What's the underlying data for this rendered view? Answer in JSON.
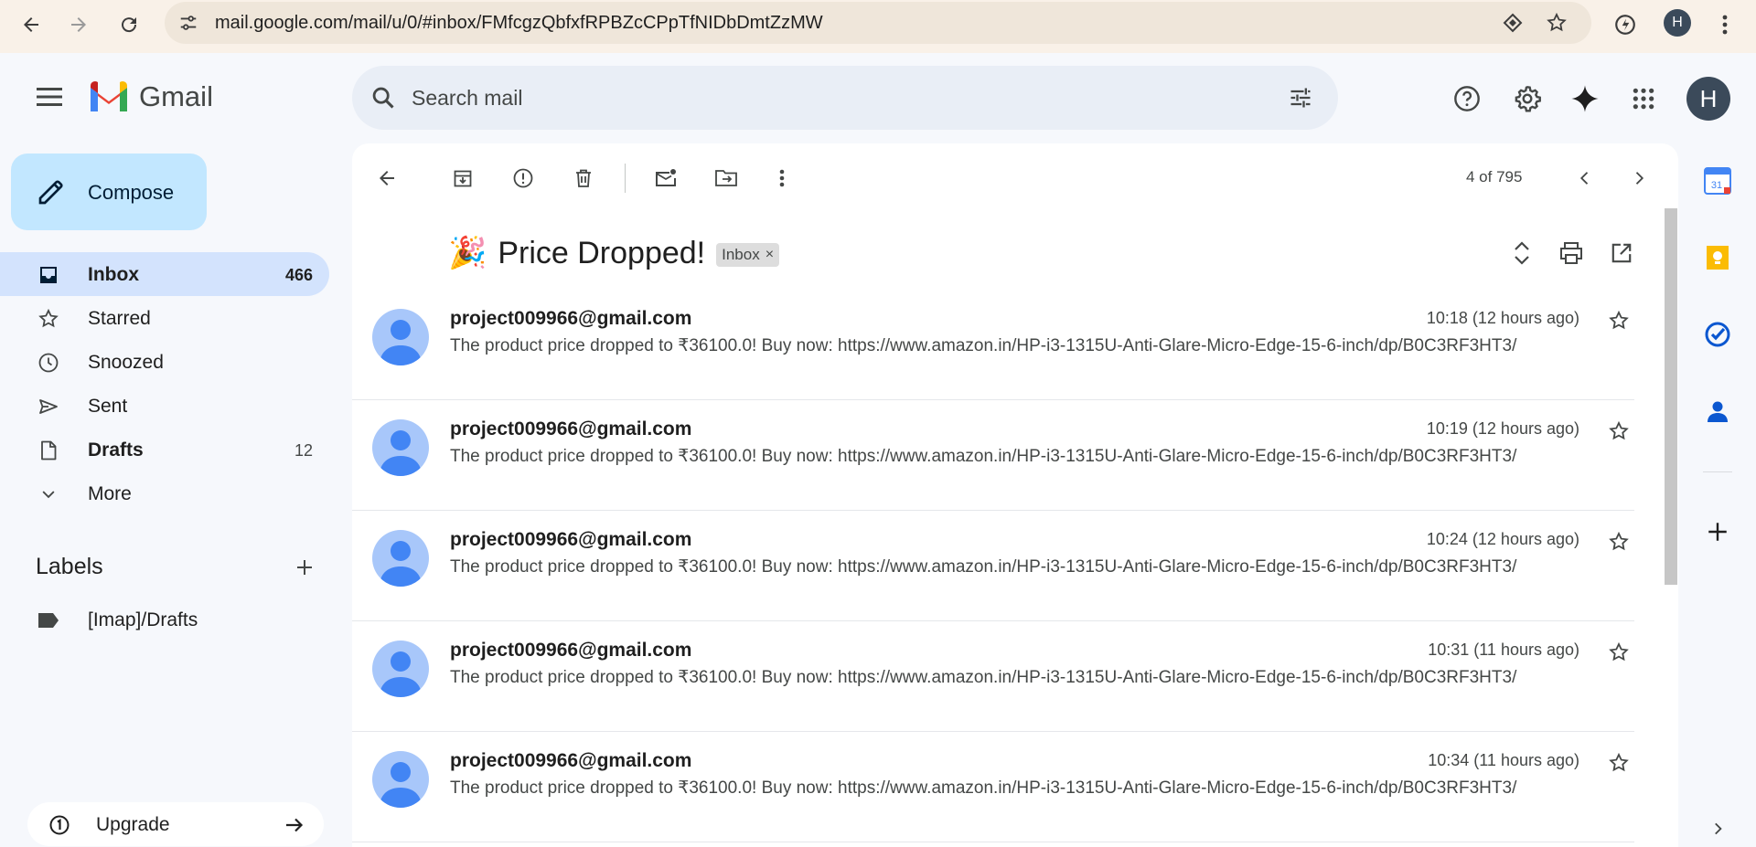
{
  "browser": {
    "url": "mail.google.com/mail/u/0/#inbox/FMfcgzQbfxfRPBZcCPpTfNIDbDmtZzMW",
    "profile_initial": "H"
  },
  "header": {
    "app_name": "Gmail",
    "search_placeholder": "Search mail",
    "account_initial": "H"
  },
  "sidebar": {
    "compose_label": "Compose",
    "items": [
      {
        "label": "Inbox",
        "count": "466"
      },
      {
        "label": "Starred",
        "count": ""
      },
      {
        "label": "Snoozed",
        "count": ""
      },
      {
        "label": "Sent",
        "count": ""
      },
      {
        "label": "Drafts",
        "count": "12"
      },
      {
        "label": "More",
        "count": ""
      }
    ],
    "labels_heading": "Labels",
    "labels": [
      {
        "label": "[Imap]/Drafts"
      }
    ],
    "upgrade_label": "Upgrade"
  },
  "toolbar": {
    "pager": "4 of 795"
  },
  "thread": {
    "emoji": "🎉",
    "subject": "Price Dropped!",
    "chip": "Inbox",
    "chip_close": "×",
    "messages": [
      {
        "from": "project009966@gmail.com",
        "time": "10:18 (12 hours ago)",
        "snippet": "The product price dropped to ₹36100.0! Buy now: https://www.amazon.in/HP-i3-1315U-Anti-Glare-Micro-Edge-15-6-inch/dp/B0C3RF3HT3/"
      },
      {
        "from": "project009966@gmail.com",
        "time": "10:19 (12 hours ago)",
        "snippet": "The product price dropped to ₹36100.0! Buy now: https://www.amazon.in/HP-i3-1315U-Anti-Glare-Micro-Edge-15-6-inch/dp/B0C3RF3HT3/"
      },
      {
        "from": "project009966@gmail.com",
        "time": "10:24 (12 hours ago)",
        "snippet": "The product price dropped to ₹36100.0! Buy now: https://www.amazon.in/HP-i3-1315U-Anti-Glare-Micro-Edge-15-6-inch/dp/B0C3RF3HT3/"
      },
      {
        "from": "project009966@gmail.com",
        "time": "10:31 (11 hours ago)",
        "snippet": "The product price dropped to ₹36100.0! Buy now: https://www.amazon.in/HP-i3-1315U-Anti-Glare-Micro-Edge-15-6-inch/dp/B0C3RF3HT3/"
      },
      {
        "from": "project009966@gmail.com",
        "time": "10:34 (11 hours ago)",
        "snippet": "The product price dropped to ₹36100.0! Buy now: https://www.amazon.in/HP-i3-1315U-Anti-Glare-Micro-Edge-15-6-inch/dp/B0C3RF3HT3/"
      }
    ]
  },
  "side_panel": {
    "calendar_day": "31"
  },
  "colors": {
    "accent": "#0b57d0",
    "compose_bg": "#c2e7ff",
    "active_nav": "#d3e3fd",
    "page_bg": "#f6f8fc"
  }
}
